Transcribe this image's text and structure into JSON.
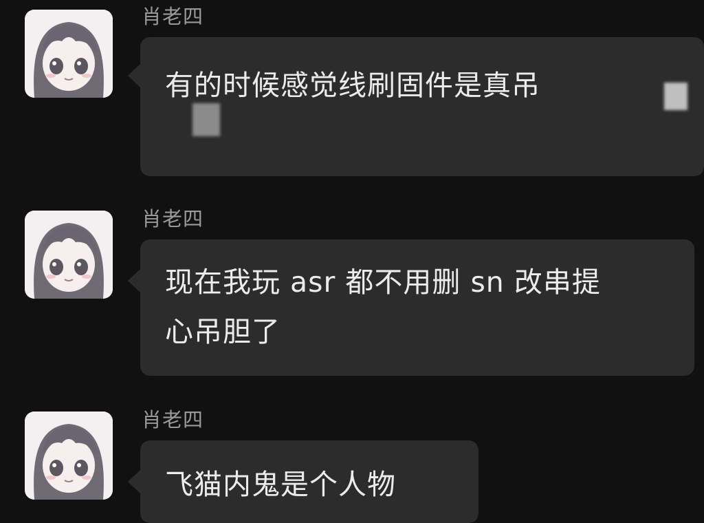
{
  "messages": [
    {
      "sender": "肖老四",
      "text_lines": [
        "有的时候感觉线刷固件是真吊"
      ]
    },
    {
      "sender": "肖老四",
      "text_lines": [
        "现在我玩 asr 都不用删 sn 改串提",
        "心吊胆了"
      ]
    },
    {
      "sender": "肖老四",
      "text_lines": [
        "飞猫内鬼是个人物"
      ]
    }
  ],
  "colors": {
    "background": "#111111",
    "bubble": "#2c2c2c",
    "text": "#ececec",
    "sender": "#9a9a9a"
  }
}
